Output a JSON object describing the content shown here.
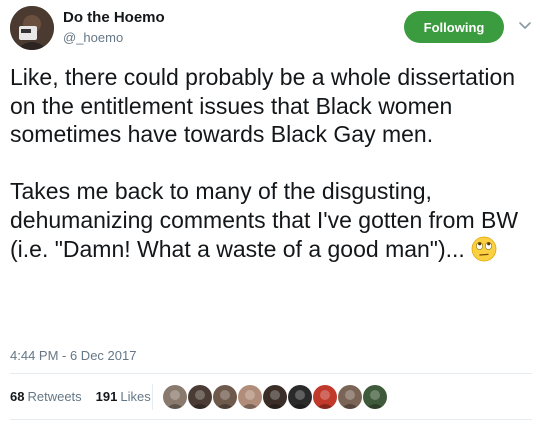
{
  "author": {
    "name": "Do the Hoemo",
    "handle": "@_hoemo",
    "avatar_icon": "profile-photo-icon"
  },
  "follow_button": {
    "label": "Following",
    "color": "#3a9b3f"
  },
  "caret_icon": "chevron-down-icon",
  "tweet": {
    "paragraph_1": "Like, there could probably be a whole dissertation on the entitlement issues that Black women sometimes have towards Black Gay men.",
    "paragraph_2": "Takes me back to many of the disgusting, dehumanizing comments that I've gotten from BW (i.e. \"Damn! What a waste of a good man\")...",
    "emoji": "face-with-rolling-eyes-icon"
  },
  "timestamp": "4:44 PM - 6 Dec 2017",
  "stats": {
    "retweets_count": "68",
    "retweets_label": "Retweets",
    "likes_count": "191",
    "likes_label": "Likes"
  },
  "likers": [
    {
      "icon": "liker-avatar-1-icon",
      "color": "#8a7a6e"
    },
    {
      "icon": "liker-avatar-2-icon",
      "color": "#4a3c34"
    },
    {
      "icon": "liker-avatar-3-icon",
      "color": "#6e5a4c"
    },
    {
      "icon": "liker-avatar-4-icon",
      "color": "#b08d7a"
    },
    {
      "icon": "liker-avatar-5-icon",
      "color": "#3b2e28"
    },
    {
      "icon": "liker-avatar-6-icon",
      "color": "#2a2a2a"
    },
    {
      "icon": "liker-avatar-7-icon",
      "color": "#c0392b"
    },
    {
      "icon": "liker-avatar-8-icon",
      "color": "#7a6456"
    },
    {
      "icon": "liker-avatar-9-icon",
      "color": "#3f5a3a"
    }
  ]
}
